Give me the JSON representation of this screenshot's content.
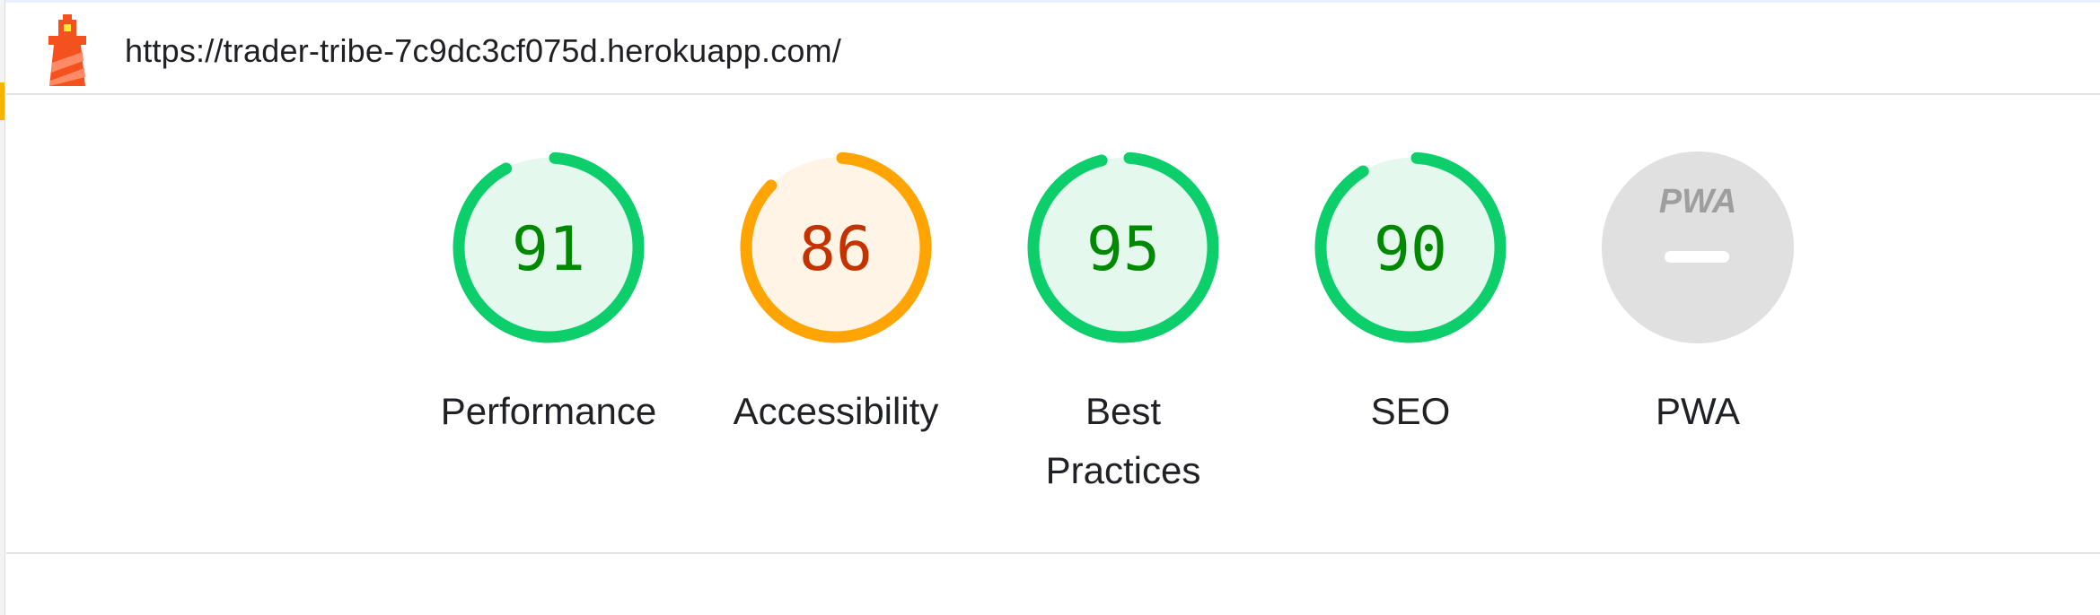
{
  "header": {
    "url": "https://trader-tribe-7c9dc3cf075d.herokuapp.com/",
    "logo_icon": "lighthouse-icon"
  },
  "categories": [
    {
      "key": "performance",
      "score": 91,
      "label": "Performance",
      "rating": "pass"
    },
    {
      "key": "accessibility",
      "score": 86,
      "label": "Accessibility",
      "rating": "average"
    },
    {
      "key": "best-practices",
      "score": 95,
      "label": "Best Practices",
      "rating": "pass"
    },
    {
      "key": "seo",
      "score": 90,
      "label": "SEO",
      "rating": "pass"
    },
    {
      "key": "pwa",
      "score": null,
      "label": "PWA",
      "rating": "na",
      "badge_text": "PWA"
    }
  ],
  "colors": {
    "pass_stroke": "#0cce6b",
    "pass_fill": "#e5f8ed",
    "pass_text": "#008800",
    "average_stroke": "#ffa400",
    "average_fill": "#fff4e6",
    "average_text": "#c33300",
    "na_fill": "#e0e0e0",
    "na_mark": "#ffffff",
    "na_text": "#9e9e9e"
  }
}
